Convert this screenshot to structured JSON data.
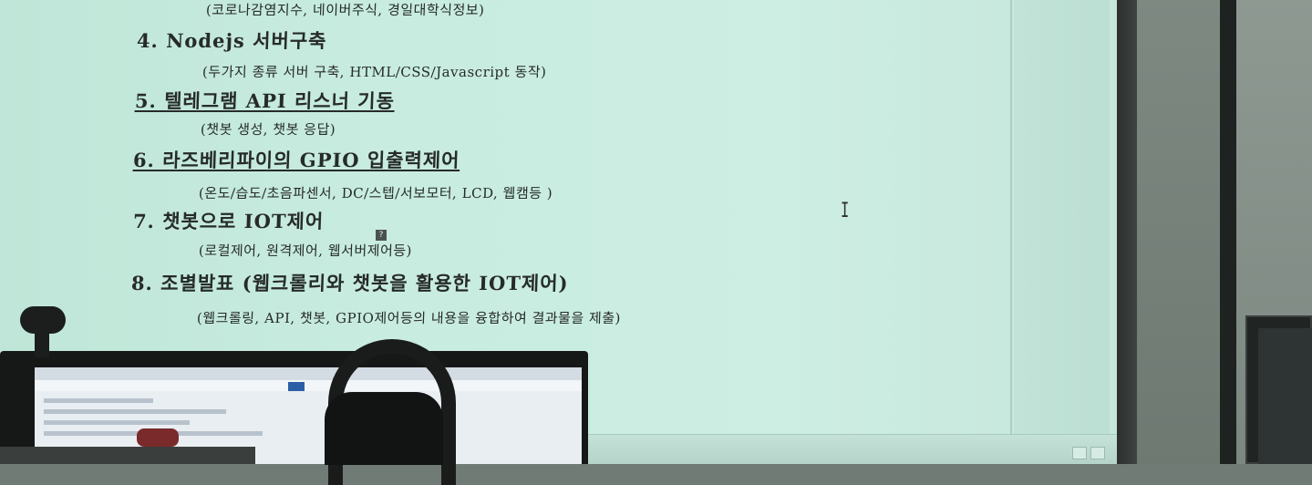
{
  "slide": {
    "lines": [
      {
        "kind": "sub",
        "text": "(코로나감염지수, 네이버주식, 경일대학식정보)"
      },
      {
        "kind": "item",
        "text": "4. Nodejs 서버구축"
      },
      {
        "kind": "sub",
        "text": "(두가지 종류 서버 구축, HTML/CSS/Javascript 동작)"
      },
      {
        "kind": "item",
        "text": "5. 텔레그램 API 리스너 기동"
      },
      {
        "kind": "sub",
        "text": "(챗봇 생성, 챗봇 응답)"
      },
      {
        "kind": "item",
        "text": "6. 라즈베리파이의 GPIO 입출력제어"
      },
      {
        "kind": "sub",
        "text": "(온도/습도/초음파센서, DC/스텝/서보모터, LCD, 웹캠등 )"
      },
      {
        "kind": "item",
        "text": "7. 챗봇으로 IOT제어"
      },
      {
        "kind": "sub",
        "text": "(로컬제어, 원격제어, 웹서버제어등)"
      },
      {
        "kind": "item",
        "text": "8. 조별발표 (웹크롤리와 챗봇을 활용한 IOT제어)"
      },
      {
        "kind": "sub",
        "text": "(웹크롤링, API, 챗봇, GPIO제어등의 내용을 융합하여 결과물을 제출)"
      }
    ],
    "tooltip_badge": "?"
  },
  "colors": {
    "screen": "#c8ece0",
    "text": "#262b29",
    "room": "#6f7b74"
  },
  "icons": {
    "cursor": "text-cursor-icon",
    "webcam": "webcam-icon",
    "headphones": "headphones-icon"
  }
}
